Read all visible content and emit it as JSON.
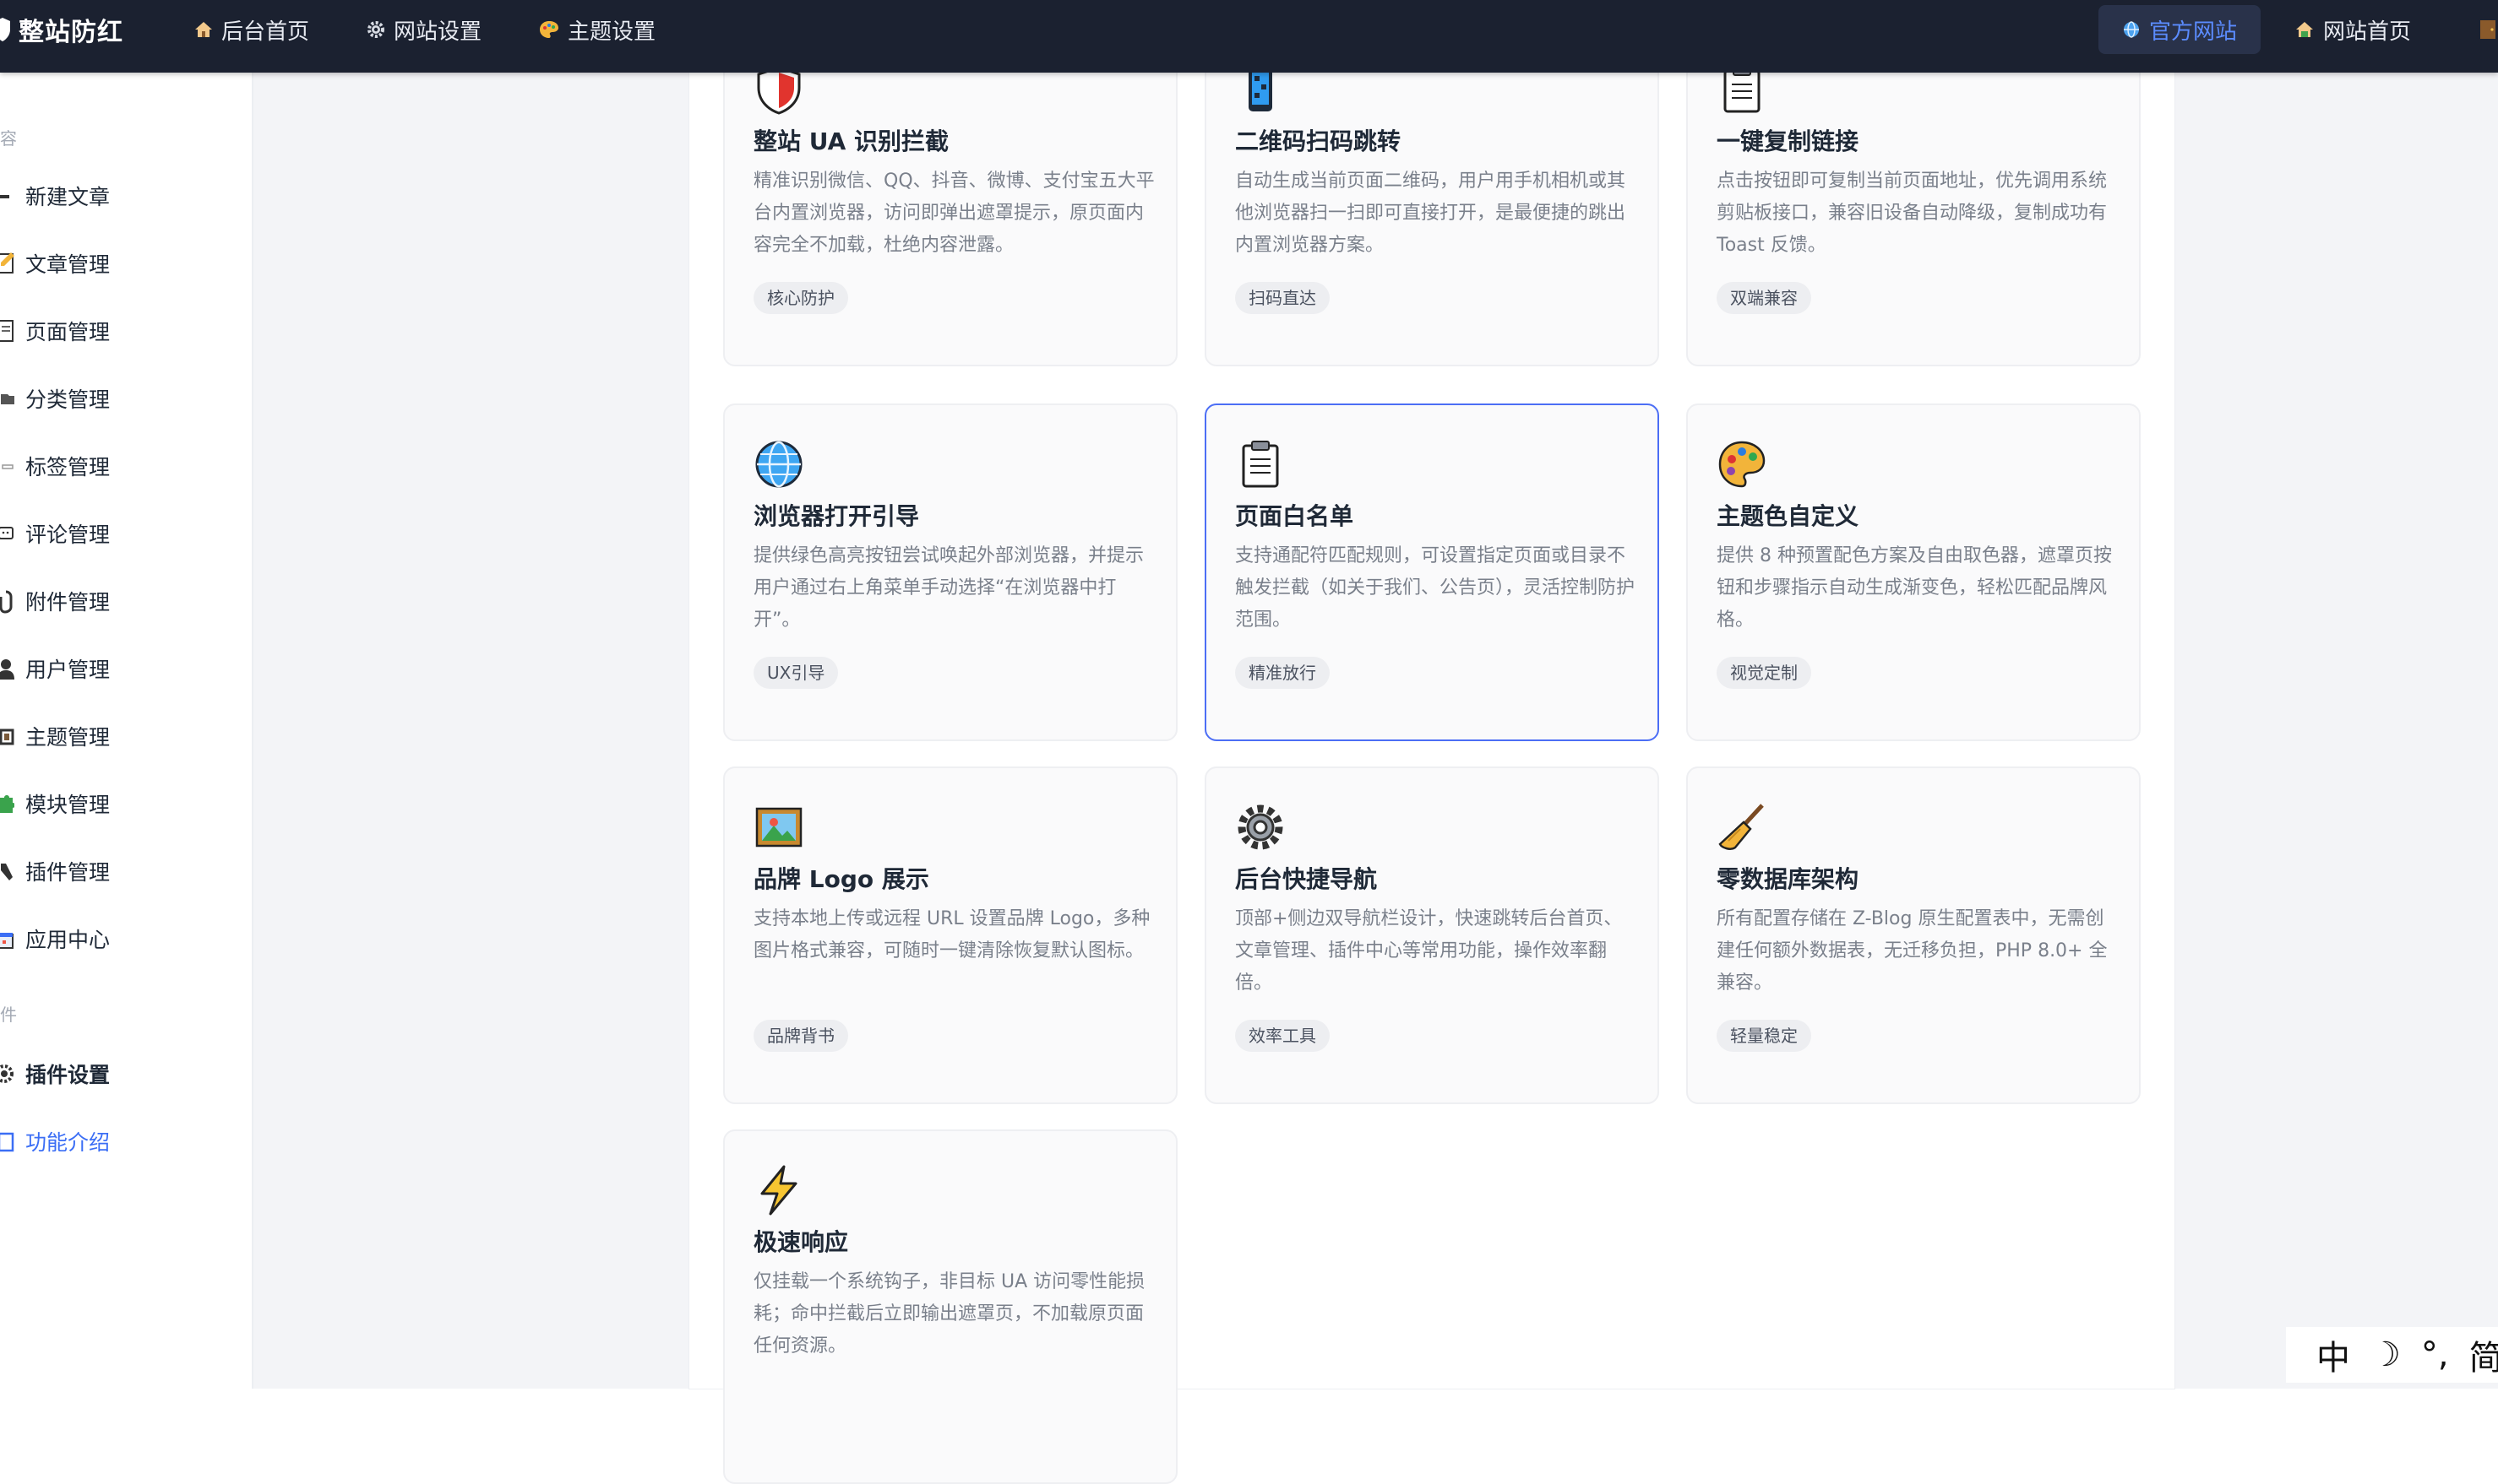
{
  "topbar": {
    "brand": "整站防红",
    "nav": [
      "后台首页",
      "网站设置",
      "主题设置"
    ],
    "official_site": "官方网站",
    "site_home": "网站首页"
  },
  "sidebar": {
    "group1": "容",
    "items": [
      "新建文章",
      "文章管理",
      "页面管理",
      "分类管理",
      "标签管理",
      "评论管理",
      "附件管理",
      "用户管理",
      "主题管理",
      "模块管理",
      "插件管理",
      "应用中心"
    ],
    "group2": "件",
    "plugin_items": [
      "插件设置",
      "功能介绍"
    ]
  },
  "cards": [
    {
      "icon": "shield-icon",
      "title": "整站 UA 识别拦截",
      "desc": "精准识别微信、QQ、抖音、微博、支付宝五大平台内置浏览器，访问即弹出遮罩提示，原页面内容完全不加载，杜绝内容泄露。",
      "tag": "核心防护"
    },
    {
      "icon": "phone-icon",
      "title": "二维码扫码跳转",
      "desc": "自动生成当前页面二维码，用户用手机相机或其他浏览器扫一扫即可直接打开，是最便捷的跳出内置浏览器方案。",
      "tag": "扫码直达"
    },
    {
      "icon": "clipboard-icon",
      "title": "一键复制链接",
      "desc": "点击按钮即可复制当前页面地址，优先调用系统剪贴板接口，兼容旧设备自动降级，复制成功有 Toast 反馈。",
      "tag": "双端兼容"
    },
    {
      "icon": "globe-icon",
      "title": "浏览器打开引导",
      "desc": "提供绿色高亮按钮尝试唤起外部浏览器，并提示用户通过右上角菜单手动选择“在浏览器中打开”。",
      "tag": "UX引导"
    },
    {
      "icon": "clipboard-icon",
      "title": "页面白名单",
      "desc": "支持通配符匹配规则，可设置指定页面或目录不触发拦截（如关于我们、公告页），灵活控制防护范围。",
      "tag": "精准放行"
    },
    {
      "icon": "palette-icon",
      "title": "主题色自定义",
      "desc": "提供 8 种预置配色方案及自由取色器，遮罩页按钮和步骤指示自动生成渐变色，轻松匹配品牌风格。",
      "tag": "视觉定制"
    },
    {
      "icon": "picture-icon",
      "title": "品牌 Logo 展示",
      "desc": "支持本地上传或远程 URL 设置品牌 Logo，多种图片格式兼容，可随时一键清除恢复默认图标。",
      "tag": "品牌背书"
    },
    {
      "icon": "gear-icon",
      "title": "后台快捷导航",
      "desc": "顶部+侧边双导航栏设计，快速跳转后台首页、文章管理、插件中心等常用功能，操作效率翻倍。",
      "tag": "效率工具"
    },
    {
      "icon": "broom-icon",
      "title": "零数据库架构",
      "desc": "所有配置存储在 Z-Blog 原生配置表中，无需创建任何额外数据表，无迁移负担，PHP 8.0+ 全兼容。",
      "tag": "轻量稳定"
    },
    {
      "icon": "lightning-icon",
      "title": "极速响应",
      "desc": "仅挂载一个系统钩子，非目标 UA 访问零性能损耗；命中拦截后立即输出遮罩页，不加载原页面任何资源。",
      "tag": ""
    }
  ],
  "ime": {
    "lang": "中",
    "moon": "☽",
    "punct": "°,",
    "extra": "简"
  }
}
